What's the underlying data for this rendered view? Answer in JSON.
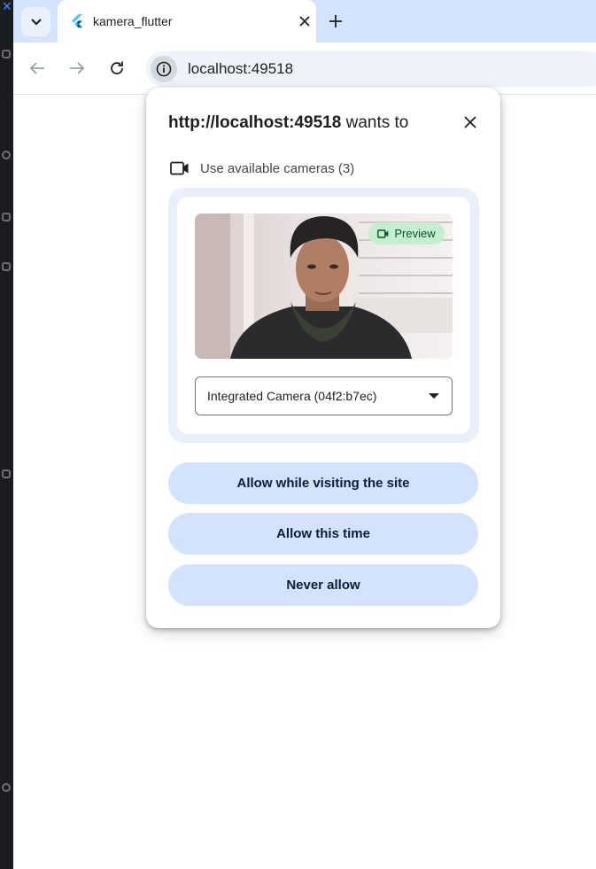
{
  "browser": {
    "tab": {
      "title": "kamera_flutter"
    },
    "address_bar": {
      "url": "localhost:49518"
    }
  },
  "permission_prompt": {
    "origin": "http://localhost:49518",
    "title_suffix": " wants to",
    "permission_label": "Use available cameras (3)",
    "preview_badge": "Preview",
    "camera_select": {
      "selected": "Integrated Camera (04f2:b7ec)"
    },
    "buttons": {
      "allow_while_visiting": "Allow while visiting the site",
      "allow_this_time": "Allow this time",
      "never_allow": "Never allow"
    }
  },
  "colors": {
    "tabstrip": "#d3e3fd",
    "button_bg": "#d3e3fd",
    "preview_badge_bg": "#c4eed0",
    "preview_frame_bg": "#e9effb"
  },
  "icons": [
    "tab-search-chevron-icon",
    "flutter-icon",
    "close-icon",
    "plus-icon",
    "back-arrow-icon",
    "forward-arrow-icon",
    "reload-icon",
    "info-icon",
    "video-camera-icon",
    "dropdown-arrow-icon"
  ]
}
